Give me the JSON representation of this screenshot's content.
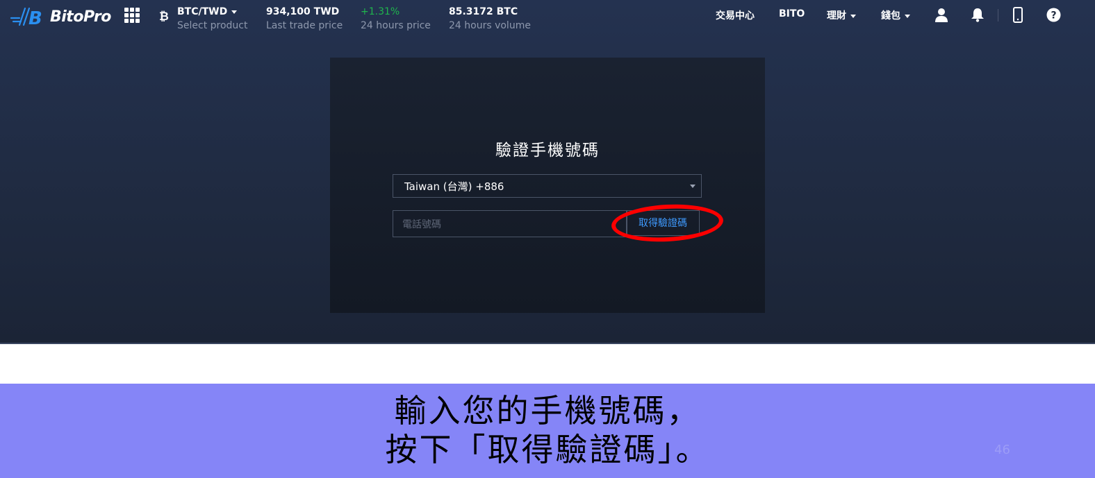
{
  "brand": {
    "name": "BitoPro"
  },
  "ticker": {
    "pair": "BTC/TWD",
    "pair_label": "Select product",
    "last_price": "934,100 TWD",
    "last_price_label": "Last trade price",
    "change": "+1.31%",
    "change_label": "24 hours price",
    "volume": "85.3172 BTC",
    "volume_label": "24 hours volume"
  },
  "nav": {
    "trade_center": "交易中心",
    "bito": "BITO",
    "finance": "理財",
    "wallet": "錢包"
  },
  "icons": {
    "apps": "grid-icon",
    "currency": "bitcoin-icon",
    "user": "user-icon",
    "notifications": "bell-icon",
    "mobile": "mobile-icon",
    "help": "help-icon"
  },
  "form": {
    "title": "驗證手機號碼",
    "country": "Taiwan (台灣) +886",
    "phone_placeholder": "電話號碼",
    "phone_value": "",
    "get_code": "取得驗證碼"
  },
  "caption": {
    "line1": "輸入您的手機號碼，",
    "line2": "按下「取得驗證碼」。",
    "page_number": "46"
  },
  "colors": {
    "positive": "#1fb54d",
    "link": "#3f9bff",
    "annotation": "#ff0000",
    "caption_bg": "#8585f7"
  }
}
